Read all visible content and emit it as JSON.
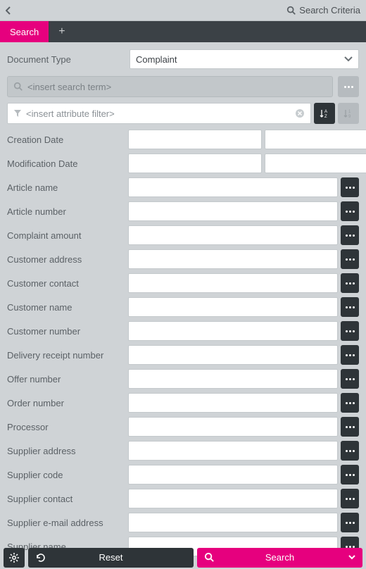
{
  "topbar": {
    "title": "Search Criteria"
  },
  "tabs": {
    "search": "Search",
    "add": "+"
  },
  "docType": {
    "label": "Document Type",
    "value": "Complaint"
  },
  "searchTerm": {
    "placeholder": "<insert search term>"
  },
  "attributeFilter": {
    "placeholder": "<insert attribute filter>"
  },
  "fields": [
    {
      "label": "Creation Date",
      "split": true
    },
    {
      "label": "Modification Date",
      "split": true
    },
    {
      "label": "Article name",
      "split": false
    },
    {
      "label": "Article number",
      "split": false
    },
    {
      "label": "Complaint amount",
      "split": false
    },
    {
      "label": "Customer address",
      "split": false
    },
    {
      "label": "Customer contact",
      "split": false
    },
    {
      "label": "Customer name",
      "split": false
    },
    {
      "label": "Customer number",
      "split": false
    },
    {
      "label": "Delivery receipt number",
      "split": false
    },
    {
      "label": "Offer number",
      "split": false
    },
    {
      "label": "Order number",
      "split": false
    },
    {
      "label": "Processor",
      "split": false
    },
    {
      "label": "Supplier address",
      "split": false
    },
    {
      "label": "Supplier code",
      "split": false
    },
    {
      "label": "Supplier contact",
      "split": false
    },
    {
      "label": "Supplier e-mail address",
      "split": false
    },
    {
      "label": "Supplier name",
      "split": false
    }
  ],
  "footer": {
    "reset": "Reset",
    "search": "Search"
  }
}
